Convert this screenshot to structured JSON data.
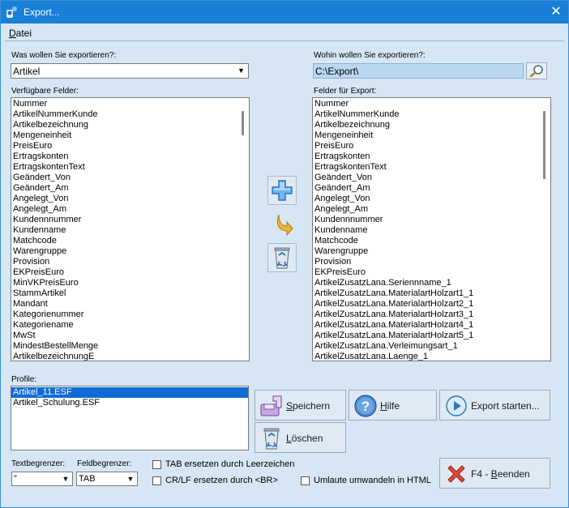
{
  "window": {
    "title": "Export..."
  },
  "menu": {
    "file_prefix": "D",
    "file_rest": "atei"
  },
  "source": {
    "label": "Was wollen Sie exportieren?:",
    "selected": "Artikel",
    "available_label": "Verfügbare Felder:",
    "available_fields": [
      "Nummer",
      "ArtikelNummerKunde",
      "Artikelbezeichnung",
      "Mengeneinheit",
      "PreisEuro",
      "Ertragskonten",
      "ErtragskontenText",
      "Geändert_Von",
      "Geändert_Am",
      "Angelegt_Von",
      "Angelegt_Am",
      "Kundennnummer",
      "Kundenname",
      "Matchcode",
      "Warengruppe",
      "Provision",
      "EKPreisEuro",
      "MinVKPreisEuro",
      "StammArtikel",
      "Mandant",
      "Kategorienummer",
      "Kategoriename",
      "MwSt",
      "MindestBestellMenge",
      "ArtikelbezeichnungE"
    ]
  },
  "target": {
    "label": "Wohin wollen Sie exportieren?:",
    "path": "C:\\Export\\",
    "export_label": "Felder für Export:",
    "export_fields": [
      "Nummer",
      "ArtikelNummerKunde",
      "Artikelbezeichnung",
      "Mengeneinheit",
      "PreisEuro",
      "Ertragskonten",
      "ErtragskontenText",
      "Geändert_Von",
      "Geändert_Am",
      "Angelegt_Von",
      "Angelegt_Am",
      "Kundennnummer",
      "Kundenname",
      "Matchcode",
      "Warengruppe",
      "Provision",
      "EKPreisEuro",
      "ArtikelZusatzLana.Seriennname_1",
      "ArtikelZusatzLana.MaterialartHolzart1_1",
      "ArtikelZusatzLana.MaterialartHolzart2_1",
      "ArtikelZusatzLana.MaterialartHolzart3_1",
      "ArtikelZusatzLana.MaterialartHolzart4_1",
      "ArtikelZusatzLana.MaterialartHolzart5_1",
      "ArtikelZusatzLana.Verleimungsart_1",
      "ArtikelZusatzLana.Laenge_1"
    ]
  },
  "profiles": {
    "label": "Profile:",
    "items": [
      "Artikel_11.ESF",
      "Artikel_Schulung.ESF"
    ]
  },
  "buttons": {
    "save_ul": "S",
    "save_rest": "peichern",
    "help_ul": "H",
    "help_rest": "ilfe",
    "export": "Export starten...",
    "delete_ul": "L",
    "delete_rest": "öschen",
    "close_pre": "F4 - ",
    "close_ul": "B",
    "close_rest": "eenden"
  },
  "options": {
    "text_delim_label": "Textbegrenzer:",
    "text_delim_value": "\"",
    "field_delim_label": "Feldbegrenzer:",
    "field_delim_value": "TAB",
    "tab_replace": "TAB ersetzen durch Leerzeichen",
    "crlf_replace": "CR/LF ersetzen durch <BR>",
    "umlaute": "Umlaute umwandeln in HTML"
  },
  "colors": {
    "titlebar": "#1a7fd6",
    "selection": "#0f6bd8",
    "dialog_bg": "#d6e6f5"
  }
}
